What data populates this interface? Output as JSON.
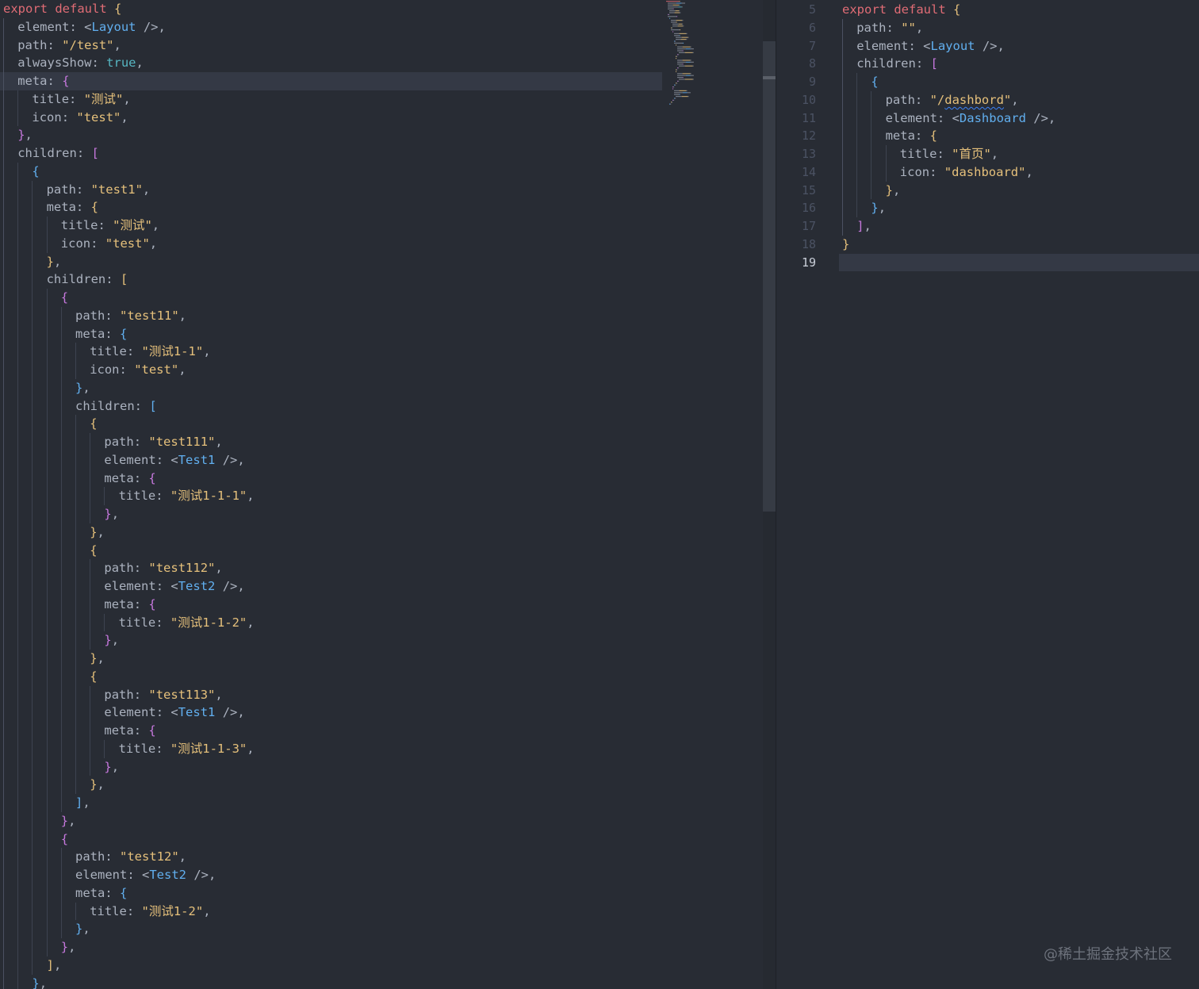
{
  "left_editor": {
    "active_line": 4,
    "lines": [
      {
        "i": 0,
        "t": [
          [
            "export default ",
            "kw"
          ],
          [
            "{",
            "b1"
          ]
        ]
      },
      {
        "i": 1,
        "t": [
          [
            "element: <",
            "p"
          ],
          [
            "Layout",
            "tag"
          ],
          [
            " />,",
            "p"
          ]
        ]
      },
      {
        "i": 1,
        "t": [
          [
            "path: ",
            "p"
          ],
          [
            "\"/test\"",
            "str"
          ],
          [
            ",",
            "p"
          ]
        ]
      },
      {
        "i": 1,
        "t": [
          [
            "alwaysShow: ",
            "p"
          ],
          [
            "true",
            "bool"
          ],
          [
            ",",
            "p"
          ]
        ]
      },
      {
        "i": 1,
        "t": [
          [
            "meta: ",
            "p"
          ],
          [
            "{",
            "b2"
          ]
        ]
      },
      {
        "i": 2,
        "t": [
          [
            "title: ",
            "p"
          ],
          [
            "\"测试\"",
            "str"
          ],
          [
            ",",
            "p"
          ]
        ]
      },
      {
        "i": 2,
        "t": [
          [
            "icon: ",
            "p"
          ],
          [
            "\"test\"",
            "str"
          ],
          [
            ",",
            "p"
          ]
        ]
      },
      {
        "i": 1,
        "t": [
          [
            "}",
            "b2"
          ],
          [
            ",",
            "p"
          ]
        ]
      },
      {
        "i": 1,
        "t": [
          [
            "children: ",
            "p"
          ],
          [
            "[",
            "b2"
          ]
        ]
      },
      {
        "i": 2,
        "t": [
          [
            "{",
            "b3"
          ]
        ]
      },
      {
        "i": 3,
        "t": [
          [
            "path: ",
            "p"
          ],
          [
            "\"test1\"",
            "str"
          ],
          [
            ",",
            "p"
          ]
        ]
      },
      {
        "i": 3,
        "t": [
          [
            "meta: ",
            "p"
          ],
          [
            "{",
            "b1"
          ]
        ]
      },
      {
        "i": 4,
        "t": [
          [
            "title: ",
            "p"
          ],
          [
            "\"测试\"",
            "str"
          ],
          [
            ",",
            "p"
          ]
        ]
      },
      {
        "i": 4,
        "t": [
          [
            "icon: ",
            "p"
          ],
          [
            "\"test\"",
            "str"
          ],
          [
            ",",
            "p"
          ]
        ]
      },
      {
        "i": 3,
        "t": [
          [
            "}",
            "b1"
          ],
          [
            ",",
            "p"
          ]
        ]
      },
      {
        "i": 3,
        "t": [
          [
            "children: ",
            "p"
          ],
          [
            "[",
            "b1"
          ]
        ]
      },
      {
        "i": 4,
        "t": [
          [
            "{",
            "b2"
          ]
        ]
      },
      {
        "i": 5,
        "t": [
          [
            "path: ",
            "p"
          ],
          [
            "\"test11\"",
            "str"
          ],
          [
            ",",
            "p"
          ]
        ]
      },
      {
        "i": 5,
        "t": [
          [
            "meta: ",
            "p"
          ],
          [
            "{",
            "b3"
          ]
        ]
      },
      {
        "i": 6,
        "t": [
          [
            "title: ",
            "p"
          ],
          [
            "\"测试1-1\"",
            "str"
          ],
          [
            ",",
            "p"
          ]
        ]
      },
      {
        "i": 6,
        "t": [
          [
            "icon: ",
            "p"
          ],
          [
            "\"test\"",
            "str"
          ],
          [
            ",",
            "p"
          ]
        ]
      },
      {
        "i": 5,
        "t": [
          [
            "}",
            "b3"
          ],
          [
            ",",
            "p"
          ]
        ]
      },
      {
        "i": 5,
        "t": [
          [
            "children: ",
            "p"
          ],
          [
            "[",
            "b3"
          ]
        ]
      },
      {
        "i": 6,
        "t": [
          [
            "{",
            "b1"
          ]
        ]
      },
      {
        "i": 7,
        "t": [
          [
            "path: ",
            "p"
          ],
          [
            "\"test111\"",
            "str"
          ],
          [
            ",",
            "p"
          ]
        ]
      },
      {
        "i": 7,
        "t": [
          [
            "element: <",
            "p"
          ],
          [
            "Test1",
            "tag"
          ],
          [
            " />,",
            "p"
          ]
        ]
      },
      {
        "i": 7,
        "t": [
          [
            "meta: ",
            "p"
          ],
          [
            "{",
            "b2"
          ]
        ]
      },
      {
        "i": 8,
        "t": [
          [
            "title: ",
            "p"
          ],
          [
            "\"测试1-1-1\"",
            "str"
          ],
          [
            ",",
            "p"
          ]
        ]
      },
      {
        "i": 7,
        "t": [
          [
            "}",
            "b2"
          ],
          [
            ",",
            "p"
          ]
        ]
      },
      {
        "i": 6,
        "t": [
          [
            "}",
            "b1"
          ],
          [
            ",",
            "p"
          ]
        ]
      },
      {
        "i": 6,
        "t": [
          [
            "{",
            "b1"
          ]
        ]
      },
      {
        "i": 7,
        "t": [
          [
            "path: ",
            "p"
          ],
          [
            "\"test112\"",
            "str"
          ],
          [
            ",",
            "p"
          ]
        ]
      },
      {
        "i": 7,
        "t": [
          [
            "element: <",
            "p"
          ],
          [
            "Test2",
            "tag"
          ],
          [
            " />,",
            "p"
          ]
        ]
      },
      {
        "i": 7,
        "t": [
          [
            "meta: ",
            "p"
          ],
          [
            "{",
            "b2"
          ]
        ]
      },
      {
        "i": 8,
        "t": [
          [
            "title: ",
            "p"
          ],
          [
            "\"测试1-1-2\"",
            "str"
          ],
          [
            ",",
            "p"
          ]
        ]
      },
      {
        "i": 7,
        "t": [
          [
            "}",
            "b2"
          ],
          [
            ",",
            "p"
          ]
        ]
      },
      {
        "i": 6,
        "t": [
          [
            "}",
            "b1"
          ],
          [
            ",",
            "p"
          ]
        ]
      },
      {
        "i": 6,
        "t": [
          [
            "{",
            "b1"
          ]
        ]
      },
      {
        "i": 7,
        "t": [
          [
            "path: ",
            "p"
          ],
          [
            "\"test113\"",
            "str"
          ],
          [
            ",",
            "p"
          ]
        ]
      },
      {
        "i": 7,
        "t": [
          [
            "element: <",
            "p"
          ],
          [
            "Test1",
            "tag"
          ],
          [
            " />,",
            "p"
          ]
        ]
      },
      {
        "i": 7,
        "t": [
          [
            "meta: ",
            "p"
          ],
          [
            "{",
            "b2"
          ]
        ]
      },
      {
        "i": 8,
        "t": [
          [
            "title: ",
            "p"
          ],
          [
            "\"测试1-1-3\"",
            "str"
          ],
          [
            ",",
            "p"
          ]
        ]
      },
      {
        "i": 7,
        "t": [
          [
            "}",
            "b2"
          ],
          [
            ",",
            "p"
          ]
        ]
      },
      {
        "i": 6,
        "t": [
          [
            "}",
            "b1"
          ],
          [
            ",",
            "p"
          ]
        ]
      },
      {
        "i": 5,
        "t": [
          [
            "]",
            "b3"
          ],
          [
            ",",
            "p"
          ]
        ]
      },
      {
        "i": 4,
        "t": [
          [
            "}",
            "b2"
          ],
          [
            ",",
            "p"
          ]
        ]
      },
      {
        "i": 4,
        "t": [
          [
            "{",
            "b2"
          ]
        ]
      },
      {
        "i": 5,
        "t": [
          [
            "path: ",
            "p"
          ],
          [
            "\"test12\"",
            "str"
          ],
          [
            ",",
            "p"
          ]
        ]
      },
      {
        "i": 5,
        "t": [
          [
            "element: <",
            "p"
          ],
          [
            "Test2",
            "tag"
          ],
          [
            " />,",
            "p"
          ]
        ]
      },
      {
        "i": 5,
        "t": [
          [
            "meta: ",
            "p"
          ],
          [
            "{",
            "b3"
          ]
        ]
      },
      {
        "i": 6,
        "t": [
          [
            "title: ",
            "p"
          ],
          [
            "\"测试1-2\"",
            "str"
          ],
          [
            ",",
            "p"
          ]
        ]
      },
      {
        "i": 5,
        "t": [
          [
            "}",
            "b3"
          ],
          [
            ",",
            "p"
          ]
        ]
      },
      {
        "i": 4,
        "t": [
          [
            "}",
            "b2"
          ],
          [
            ",",
            "p"
          ]
        ]
      },
      {
        "i": 3,
        "t": [
          [
            "]",
            "b1"
          ],
          [
            ",",
            "p"
          ]
        ]
      },
      {
        "i": 2,
        "t": [
          [
            "}",
            "b3"
          ],
          [
            ",",
            "p"
          ]
        ]
      }
    ]
  },
  "right_editor": {
    "current_line_number": "19",
    "lines": [
      {
        "n": "5",
        "i": 0,
        "t": [
          [
            "export default ",
            "kw"
          ],
          [
            "{",
            "b1"
          ]
        ]
      },
      {
        "n": "6",
        "i": 1,
        "t": [
          [
            "path: ",
            "p"
          ],
          [
            "\"\"",
            "str"
          ],
          [
            ",",
            "p"
          ]
        ]
      },
      {
        "n": "7",
        "i": 1,
        "t": [
          [
            "element: <",
            "p"
          ],
          [
            "Layout",
            "tag"
          ],
          [
            " />,",
            "p"
          ]
        ]
      },
      {
        "n": "8",
        "i": 1,
        "t": [
          [
            "children: ",
            "p"
          ],
          [
            "[",
            "b2"
          ]
        ]
      },
      {
        "n": "9",
        "i": 2,
        "t": [
          [
            "{",
            "b3"
          ]
        ]
      },
      {
        "n": "10",
        "i": 3,
        "t": [
          [
            "path: ",
            "p"
          ],
          [
            "\"/",
            "str"
          ],
          [
            "dashbord",
            "str squiggle"
          ],
          [
            "\"",
            "str"
          ],
          [
            ",",
            "p"
          ]
        ]
      },
      {
        "n": "11",
        "i": 3,
        "t": [
          [
            "element: <",
            "p"
          ],
          [
            "Dashboard",
            "tag"
          ],
          [
            " />,",
            "p"
          ]
        ]
      },
      {
        "n": "12",
        "i": 3,
        "t": [
          [
            "meta: ",
            "p"
          ],
          [
            "{",
            "b1"
          ]
        ]
      },
      {
        "n": "13",
        "i": 4,
        "t": [
          [
            "title: ",
            "p"
          ],
          [
            "\"首页\"",
            "str"
          ],
          [
            ",",
            "p"
          ]
        ]
      },
      {
        "n": "14",
        "i": 4,
        "t": [
          [
            "icon: ",
            "p"
          ],
          [
            "\"dashboard\"",
            "str"
          ],
          [
            ",",
            "p"
          ]
        ]
      },
      {
        "n": "15",
        "i": 3,
        "t": [
          [
            "}",
            "b1"
          ],
          [
            ",",
            "p"
          ]
        ]
      },
      {
        "n": "16",
        "i": 2,
        "t": [
          [
            "}",
            "b3"
          ],
          [
            ",",
            "p"
          ]
        ]
      },
      {
        "n": "17",
        "i": 1,
        "t": [
          [
            "]",
            "b2"
          ],
          [
            ",",
            "p"
          ]
        ]
      },
      {
        "n": "18",
        "i": 0,
        "t": [
          [
            "}",
            "b1"
          ]
        ]
      },
      {
        "n": "19",
        "i": 0,
        "t": []
      }
    ]
  },
  "watermark": "@稀土掘金技术社区"
}
